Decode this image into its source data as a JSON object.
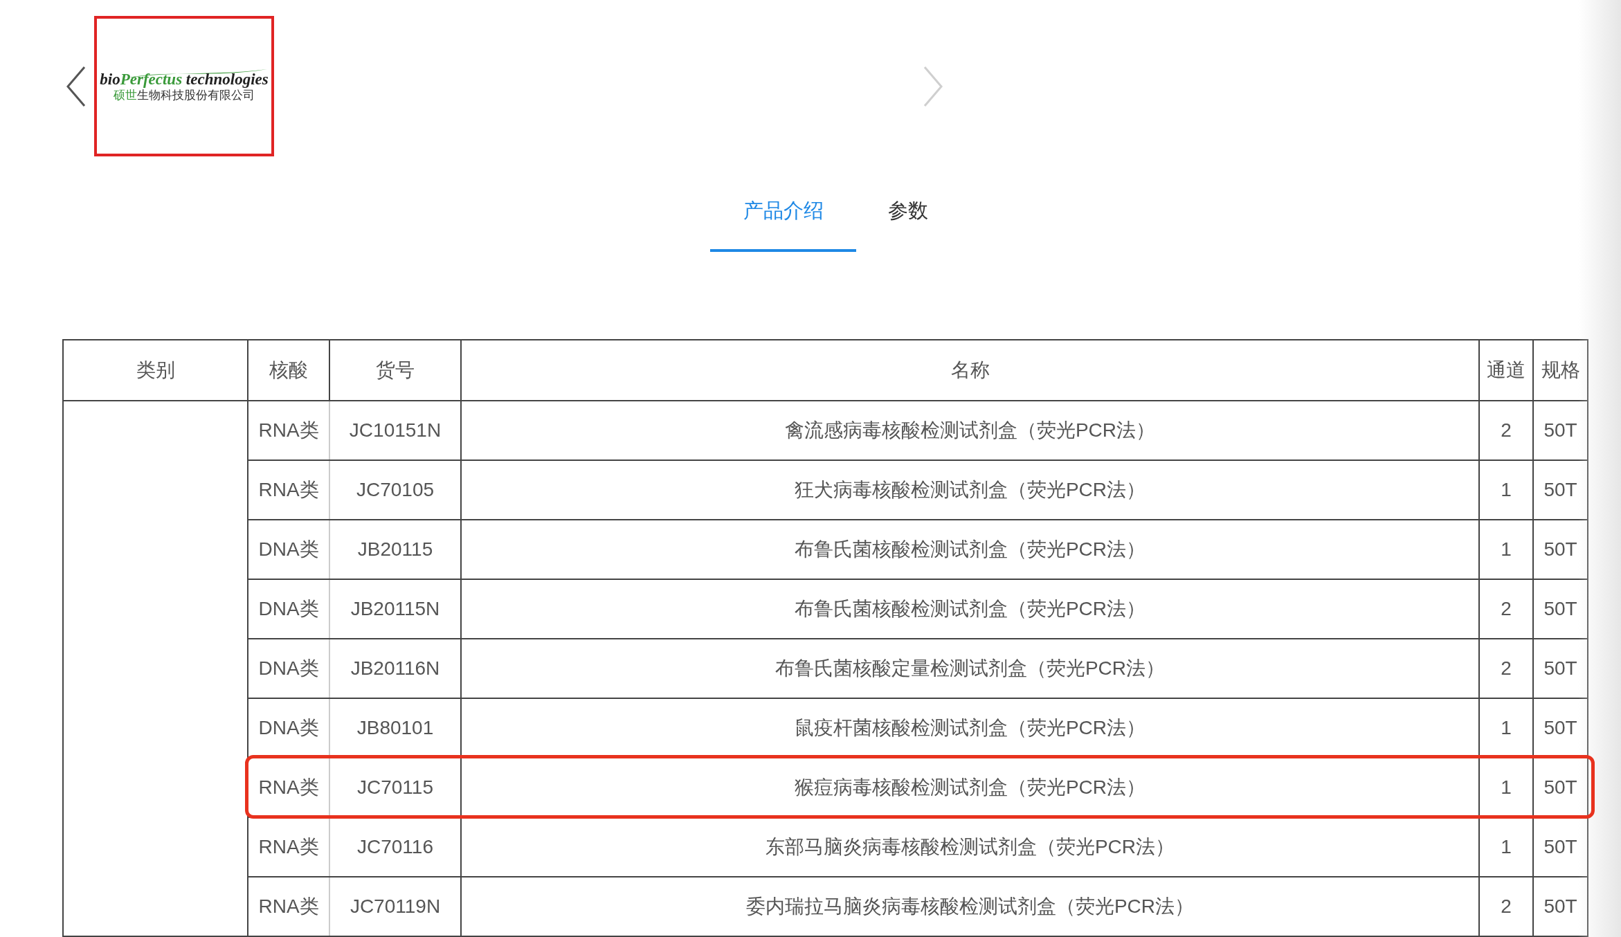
{
  "carousel": {
    "prev": {
      "disabled": false
    },
    "next": {
      "disabled": true
    },
    "logo": {
      "highlighted": true,
      "line_1": [
        {
          "text": "bio",
          "accent": false
        },
        {
          "text": "Perfectus",
          "accent": true
        },
        {
          "text": " technologies",
          "accent": false
        }
      ],
      "line_2": [
        {
          "text": "硕世",
          "accent": true
        },
        {
          "text": "生物科技股份有限公司",
          "accent": false
        }
      ]
    }
  },
  "tabs": [
    {
      "label": "产品介绍",
      "selected": true
    },
    {
      "label": "参数",
      "selected": false
    }
  ],
  "table": {
    "columns": [
      "类别",
      "核酸",
      "货号",
      "名称",
      "通道",
      "规格"
    ],
    "rows": [
      {
        "nucleic": "RNA类",
        "code": "JC10151N",
        "name": "禽流感病毒核酸检测试剂盒（荧光PCR法）",
        "channels": "2",
        "spec": "50T",
        "highlighted": false
      },
      {
        "nucleic": "RNA类",
        "code": "JC70105",
        "name": "狂犬病毒核酸检测试剂盒（荧光PCR法）",
        "channels": "1",
        "spec": "50T",
        "highlighted": false
      },
      {
        "nucleic": "DNA类",
        "code": "JB20115",
        "name": "布鲁氏菌核酸检测试剂盒（荧光PCR法）",
        "channels": "1",
        "spec": "50T",
        "highlighted": false
      },
      {
        "nucleic": "DNA类",
        "code": "JB20115N",
        "name": "布鲁氏菌核酸检测试剂盒（荧光PCR法）",
        "channels": "2",
        "spec": "50T",
        "highlighted": false
      },
      {
        "nucleic": "DNA类",
        "code": "JB20116N",
        "name": "布鲁氏菌核酸定量检测试剂盒（荧光PCR法）",
        "channels": "2",
        "spec": "50T",
        "highlighted": false
      },
      {
        "nucleic": "DNA类",
        "code": "JB80101",
        "name": "鼠疫杆菌核酸检测试剂盒（荧光PCR法）",
        "channels": "1",
        "spec": "50T",
        "highlighted": false
      },
      {
        "nucleic": "RNA类",
        "code": "JC70115",
        "name": "猴痘病毒核酸检测试剂盒（荧光PCR法）",
        "channels": "1",
        "spec": "50T",
        "highlighted": true
      },
      {
        "nucleic": "RNA类",
        "code": "JC70116",
        "name": "东部马脑炎病毒核酸检测试剂盒（荧光PCR法）",
        "channels": "1",
        "spec": "50T",
        "highlighted": false
      },
      {
        "nucleic": "RNA类",
        "code": "JC70119N",
        "name": "委内瑞拉马脑炎病毒核酸检测试剂盒（荧光PCR法）",
        "channels": "2",
        "spec": "50T",
        "highlighted": false
      }
    ]
  }
}
